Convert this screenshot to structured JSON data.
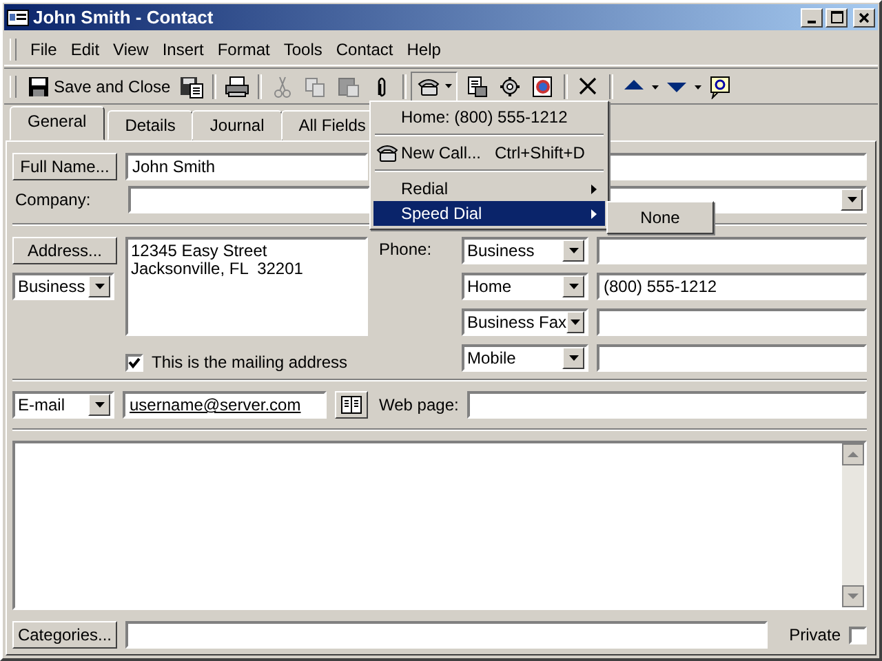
{
  "window": {
    "title": "John Smith - Contact"
  },
  "menu_bar": [
    "File",
    "Edit",
    "View",
    "Insert",
    "Format",
    "Tools",
    "Contact",
    "Help"
  ],
  "toolbar": {
    "save_and_close": "Save and Close"
  },
  "tabs": [
    {
      "label": "General",
      "selected": true
    },
    {
      "label": "Details",
      "selected": false
    },
    {
      "label": "Journal",
      "selected": false
    },
    {
      "label": "All Fields",
      "selected": false
    }
  ],
  "form": {
    "full_name_button": "Full Name...",
    "full_name": "John Smith",
    "company_label": "Company:",
    "address_button": "Address...",
    "address_type": "Business",
    "address": "12345 Easy Street\nJacksonville, FL  32201",
    "mailing_address": {
      "label": "This is the mailing address",
      "checked": true
    },
    "phone_label": "Phone:",
    "phones": [
      {
        "type": "Business"
      },
      {
        "type": "Home",
        "number": "(800) 555-1212"
      },
      {
        "type": "Business Fax"
      },
      {
        "type": "Mobile"
      }
    ],
    "email_type": "E-mail",
    "email": "username@server.com",
    "web_page_label": "Web page:",
    "categories_button": "Categories...",
    "private": {
      "label": "Private",
      "checked": false
    }
  },
  "dial_menu": {
    "items": [
      {
        "kind": "item",
        "label": "Home: (800) 555-1212",
        "selected": false
      },
      {
        "kind": "separator"
      },
      {
        "kind": "icon-item",
        "label": "New Call...",
        "shortcut": "Ctrl+Shift+D",
        "selected": false
      },
      {
        "kind": "separator"
      },
      {
        "kind": "submenu",
        "label": "Redial",
        "selected": false
      },
      {
        "kind": "submenu",
        "label": "Speed Dial",
        "selected": true
      }
    ],
    "submenu": {
      "items": [
        {
          "label": "None"
        }
      ]
    }
  }
}
